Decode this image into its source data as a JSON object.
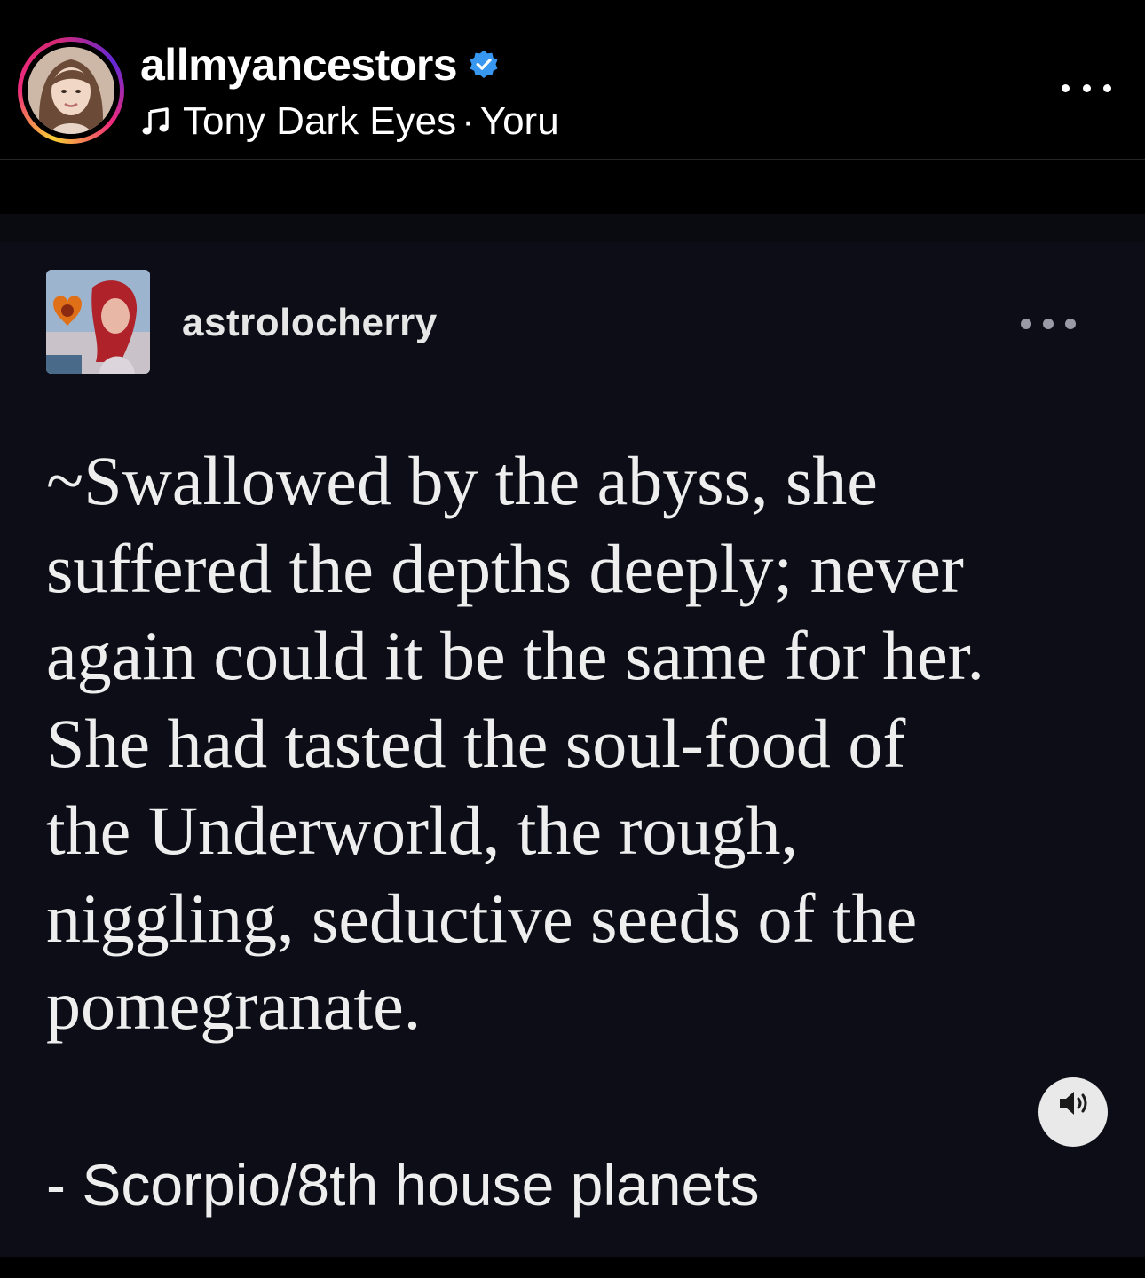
{
  "post_header": {
    "username": "allmyancestors",
    "verified": true,
    "audio_artist": "Tony Dark Eyes",
    "audio_separator": "·",
    "audio_track": "Yoru",
    "more_icon": "more-horizontal-icon"
  },
  "reposted_image": {
    "tumblr_username": "astrolocherry",
    "more_icon": "more-horizontal-icon",
    "quote_lines": [
      "~Swallowed by the abyss, she",
      "suffered the depths deeply; never",
      "again could it be the same for her.",
      "She had tasted the soul-food of",
      "the Underworld, the rough,",
      "niggling, seductive seeds of the",
      "pomegranate."
    ],
    "signature": "- Scorpio/8th house planets"
  },
  "audio_toggle_icon": "speaker-icon",
  "colors": {
    "background": "#000000",
    "card_background": "#0d0d17",
    "verified_badge": "#3897f0",
    "text": "#ffffff"
  }
}
